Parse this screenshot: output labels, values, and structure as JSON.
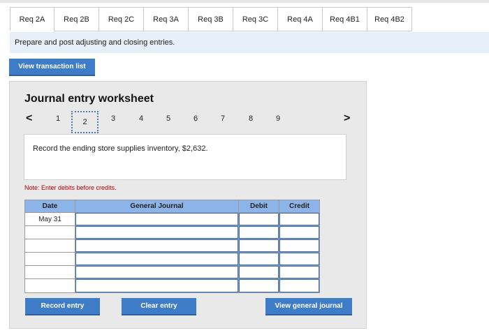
{
  "tabs": [
    "Req 2A",
    "Req 2B",
    "Req 2C",
    "Req 3A",
    "Req 3B",
    "Req 3C",
    "Req 4A",
    "Req 4B1",
    "Req 4B2"
  ],
  "instruction": "Prepare and post adjusting and closing entries.",
  "view_transaction_list": "View transaction list",
  "worksheet": {
    "title": "Journal entry worksheet",
    "prev_arrow": "<",
    "next_arrow": ">",
    "pages": [
      "1",
      "2",
      "3",
      "4",
      "5",
      "6",
      "7",
      "8",
      "9"
    ],
    "active_page": "2",
    "description": "Record the ending store supplies inventory, $2,632.",
    "note": "Note: Enter debits before credits.",
    "table": {
      "headers": {
        "date": "Date",
        "account": "General Journal",
        "debit": "Debit",
        "credit": "Credit"
      },
      "rows": [
        {
          "date": "May 31",
          "account": "",
          "debit": "",
          "credit": ""
        },
        {
          "date": "",
          "account": "",
          "debit": "",
          "credit": ""
        },
        {
          "date": "",
          "account": "",
          "debit": "",
          "credit": ""
        },
        {
          "date": "",
          "account": "",
          "debit": "",
          "credit": ""
        },
        {
          "date": "",
          "account": "",
          "debit": "",
          "credit": ""
        },
        {
          "date": "",
          "account": "",
          "debit": "",
          "credit": ""
        }
      ]
    },
    "buttons": {
      "record": "Record entry",
      "clear": "Clear entry",
      "view_general": "View general journal"
    }
  }
}
